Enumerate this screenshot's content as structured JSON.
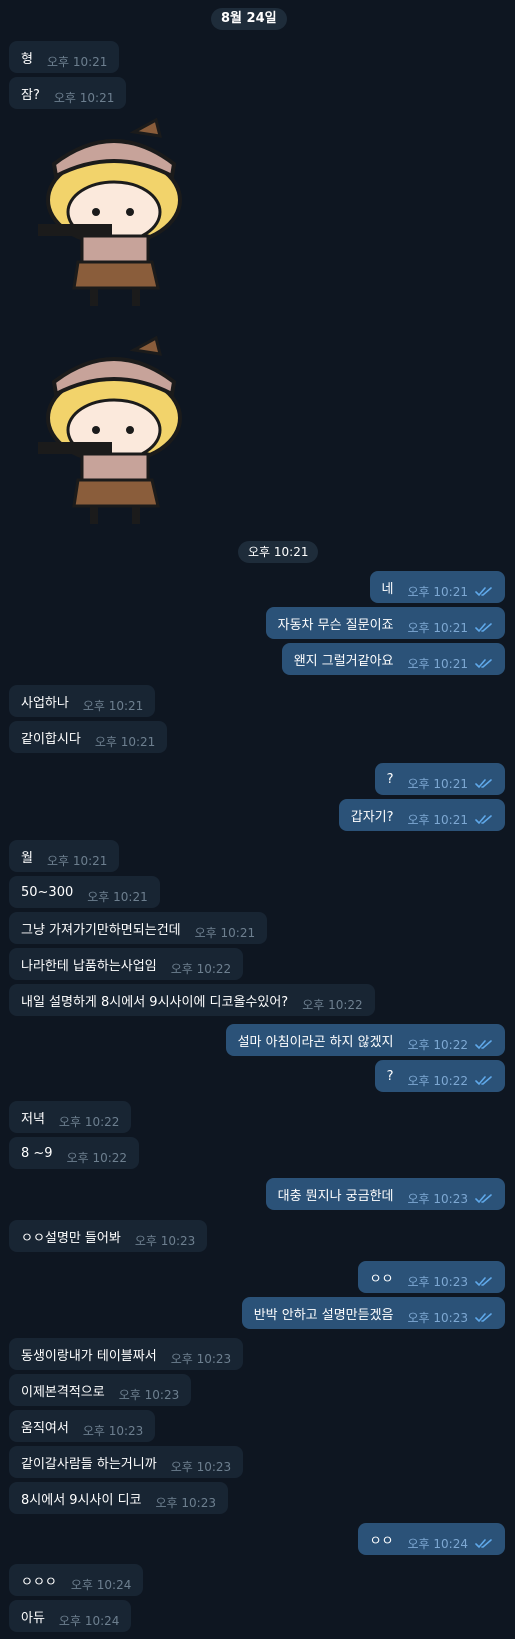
{
  "date_label": "8월 24일",
  "sticker_time": "오후 10:21",
  "messages": [
    {
      "dir": "in",
      "text": "형",
      "time": "오후 10:21"
    },
    {
      "dir": "in",
      "text": "잠?",
      "time": "오후 10:21"
    },
    {
      "dir": "out",
      "text": "네",
      "time": "오후 10:21"
    },
    {
      "dir": "out",
      "text": "자동차 무슨 질문이죠",
      "time": "오후 10:21"
    },
    {
      "dir": "out",
      "text": "왠지 그럴거같아요",
      "time": "오후 10:21"
    },
    {
      "dir": "in",
      "text": "사업하나",
      "time": "오후 10:21"
    },
    {
      "dir": "in",
      "text": "같이합시다",
      "time": "오후 10:21"
    },
    {
      "dir": "out",
      "text": "?",
      "time": "오후 10:21"
    },
    {
      "dir": "out",
      "text": "갑자기?",
      "time": "오후 10:21"
    },
    {
      "dir": "in",
      "text": "월",
      "time": "오후 10:21"
    },
    {
      "dir": "in",
      "text": "50~300",
      "time": "오후 10:21"
    },
    {
      "dir": "in",
      "text": "그냥 가져가기만하면되는건데",
      "time": "오후 10:21"
    },
    {
      "dir": "in",
      "text": "나라한테 납품하는사업임",
      "time": "오후 10:22"
    },
    {
      "dir": "in",
      "text": "내일 설명하게 8시에서 9시사이에 디코올수있어?",
      "time": "오후 10:22"
    },
    {
      "dir": "out",
      "text": "설마 아침이라곤 하지 않겠지",
      "time": "오후 10:22"
    },
    {
      "dir": "out",
      "text": "?",
      "time": "오후 10:22"
    },
    {
      "dir": "in",
      "text": "저녁",
      "time": "오후 10:22"
    },
    {
      "dir": "in",
      "text": "8 ~9",
      "time": "오후 10:22"
    },
    {
      "dir": "out",
      "text": "대충 뭔지나 궁금한데",
      "time": "오후 10:23"
    },
    {
      "dir": "in",
      "text": "ㅇㅇ설명만 들어봐",
      "time": "오후 10:23"
    },
    {
      "dir": "out",
      "text": "ㅇㅇ",
      "time": "오후 10:23"
    },
    {
      "dir": "out",
      "text": "반박 안하고 설명만듣겠음",
      "time": "오후 10:23"
    },
    {
      "dir": "in",
      "text": "동생이랑내가 테이블짜서",
      "time": "오후 10:23"
    },
    {
      "dir": "in",
      "text": "이제본격적으로",
      "time": "오후 10:23"
    },
    {
      "dir": "in",
      "text": "움직여서",
      "time": "오후 10:23"
    },
    {
      "dir": "in",
      "text": "같이갈사람들 하는거니까",
      "time": "오후 10:23"
    },
    {
      "dir": "in",
      "text": "8시에서 9시사이 디코",
      "time": "오후 10:23"
    },
    {
      "dir": "out",
      "text": "ㅇㅇ",
      "time": "오후 10:24"
    },
    {
      "dir": "in",
      "text": "ㅇㅇㅇ",
      "time": "오후 10:24"
    },
    {
      "dir": "in",
      "text": "아듀",
      "time": "오후 10:24"
    }
  ],
  "colors": {
    "background": "#0e1621",
    "incoming_bubble": "#182533",
    "outgoing_bubble": "#2b5278",
    "read_check": "#5fa8e9"
  },
  "icons": {
    "read_receipt": "double-check-icon",
    "sticker": "detective-girl-sticker"
  }
}
